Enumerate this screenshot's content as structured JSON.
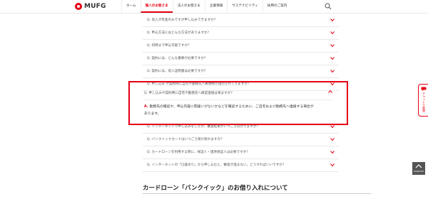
{
  "header": {
    "brand": "MUFG",
    "nav": [
      {
        "label": "ホーム",
        "active": false
      },
      {
        "label": "個人のお客さま",
        "active": true
      },
      {
        "label": "法人のお客さま",
        "active": false
      },
      {
        "label": "企業情報",
        "active": false
      },
      {
        "label": "サステナビリティ",
        "active": false
      },
      {
        "label": "採用のご案内",
        "active": false
      }
    ]
  },
  "faq": {
    "items": [
      "Q. 収入が年金のみですが申し込みできますか？",
      "Q. 申込方法にはどんな方法がありますか？",
      "Q. 何時まで申込可能ですか？",
      "Q. 契約には、どんな書類が必要ですか？",
      "Q. 契約には、収入証明書は必要ですか？",
      "Q. 申し込み や契約時に自宅や勤務先へ郵便物が送付されてきますか？"
    ],
    "open": {
      "question": "Q. 申し込みや契約時に自宅や勤務先へ確認連絡は来ますか？",
      "answer_label": "A.",
      "answer": "勤務先の確認や、申込内容に間違いがないかなどを確認するために、ご自宅および勤務先へ連絡する場合があります。"
    },
    "items_after": [
      "Q. インターネットで申し込みをしたが、審査結果がいつごろ分かりますか？",
      "Q. バンクイックカードはいつごろ受け取れますか？",
      "Q. カードローンを利用する際に、保証人・連帯保証人は必要ですか？",
      "Q. インターネットの「口座あり」から申し込むと、審査が進まない。どうすればいいですか？"
    ]
  },
  "section": {
    "title": "カードローン「バンクイック」のお借り入れについて"
  },
  "chat_tab": {
    "label": "チャットで質問"
  },
  "pagetop": {
    "label": "PAGETOP"
  },
  "colors": {
    "accent": "#e60012"
  }
}
